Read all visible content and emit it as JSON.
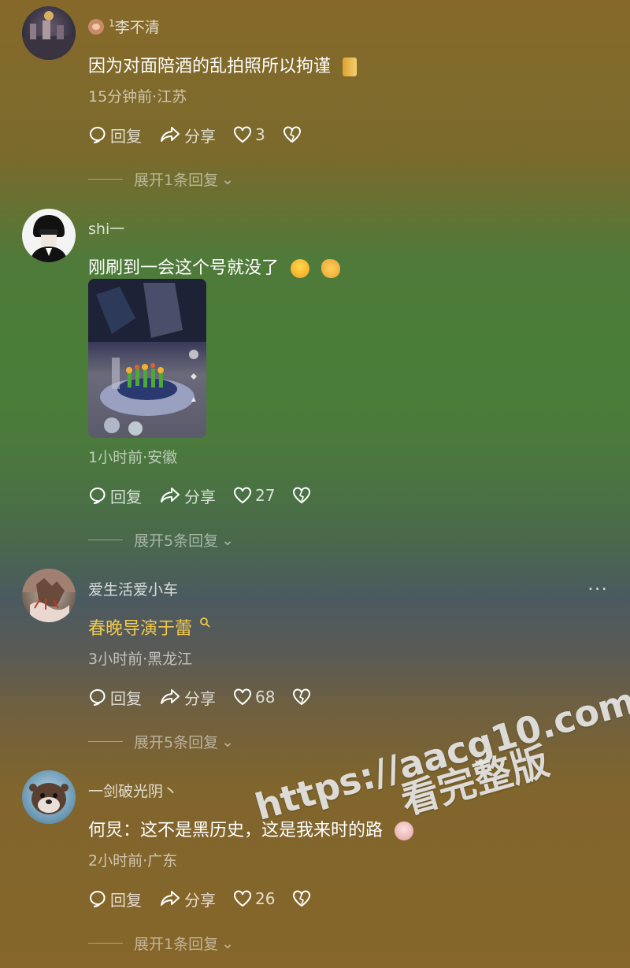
{
  "comments": [
    {
      "name": "李不清",
      "name_prefix": "1",
      "text": "因为对面陪酒的乱拍照所以拘谨",
      "meta": "15分钟前·江苏",
      "reply_label": "回复",
      "share_label": "分享",
      "likes": "3",
      "expand_label": "展开1条回复"
    },
    {
      "name": "shi一",
      "text": "刚刷到一会这个号就没了",
      "meta": "1小时前·安徽",
      "reply_label": "回复",
      "share_label": "分享",
      "likes": "27",
      "expand_label": "展开5条回复"
    },
    {
      "name": "爱生活爱小车",
      "text": "春晚导演于蕾",
      "meta": "3小时前·黑龙江",
      "reply_label": "回复",
      "share_label": "分享",
      "likes": "68",
      "expand_label": "展开5条回复",
      "more_label": "···"
    },
    {
      "name": "一剑破光阴丶",
      "text": "何炅：这不是黑历史，这是我来时的路",
      "meta": "2小时前·广东",
      "reply_label": "回复",
      "share_label": "分享",
      "likes": "26",
      "expand_label": "展开1条回复"
    }
  ],
  "watermark": {
    "line1": "https://aacg10.com",
    "line2": "看完整版"
  },
  "colors": {
    "link_text": "#f2c94c",
    "text": "#ffffff"
  }
}
